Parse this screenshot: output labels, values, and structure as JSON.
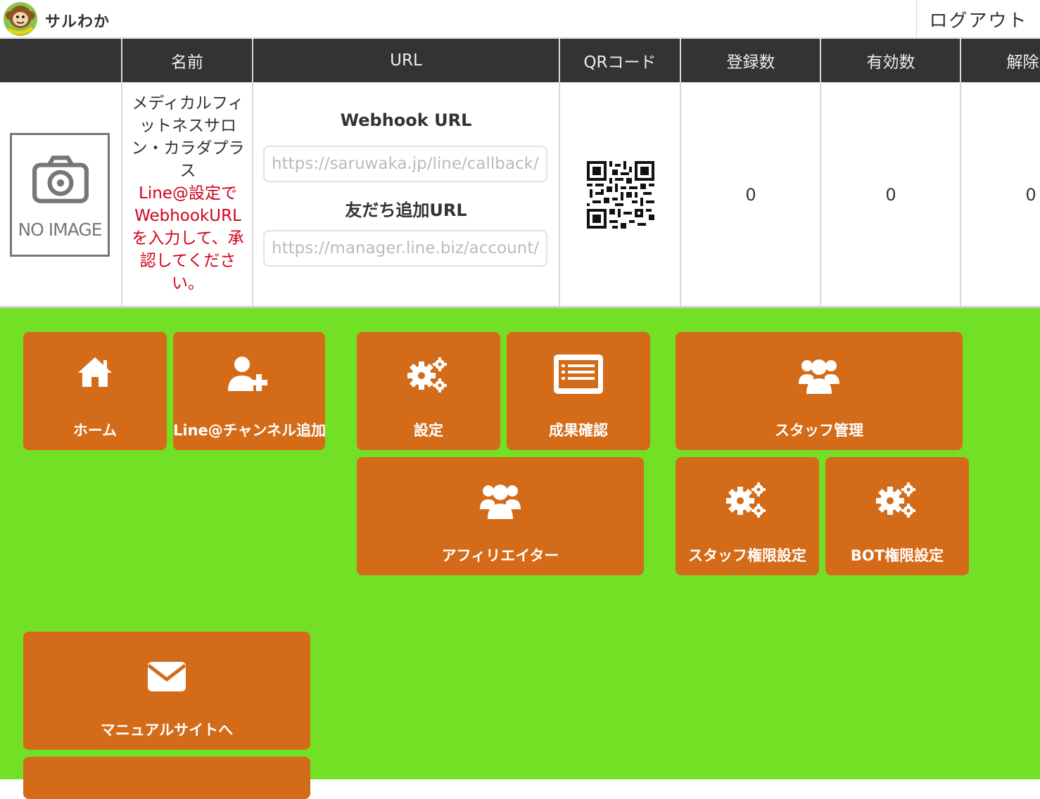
{
  "header": {
    "brand": "サルわか",
    "logout_label": "ログアウト"
  },
  "table": {
    "headers": [
      "",
      "名前",
      "URL",
      "QRコード",
      "登録数",
      "有効数",
      "解除数"
    ],
    "row": {
      "image_placeholder": "NO IMAGE",
      "name": "メディカルフィットネスサロン・カラダプラス",
      "warning": "Line@設定でWebhookURLを入力して、承認してください。",
      "webhook_label": "Webhook URL",
      "webhook_value": "https://saruwaka.jp/line/callback/",
      "friend_label": "友だち追加URL",
      "friend_value": "https://manager.line.biz/account/",
      "registered": "0",
      "active": "0",
      "cancelled": "0"
    }
  },
  "menu": {
    "home": {
      "label": "ホーム",
      "icon": "home-icon"
    },
    "add_channel": {
      "label": "Line@チャンネル追加",
      "icon": "add-user-icon"
    },
    "settings": {
      "label": "設定",
      "icon": "gears-icon"
    },
    "results": {
      "label": "成果確認",
      "icon": "list-icon"
    },
    "staff": {
      "label": "スタッフ管理",
      "icon": "users-icon"
    },
    "affiliate": {
      "label": "アフィリエイター",
      "icon": "users-icon"
    },
    "staff_perm": {
      "label": "スタッフ権限設定",
      "icon": "gears-icon"
    },
    "bot_perm": {
      "label": "BOT権限設定",
      "icon": "gears-icon"
    },
    "manual": {
      "label": "マニュアルサイトへ",
      "icon": "envelope-icon"
    }
  },
  "colors": {
    "header_bg": "#333333",
    "panel_bg": "#72e125",
    "tile_bg": "#d46b18",
    "warning": "#d0021b"
  }
}
